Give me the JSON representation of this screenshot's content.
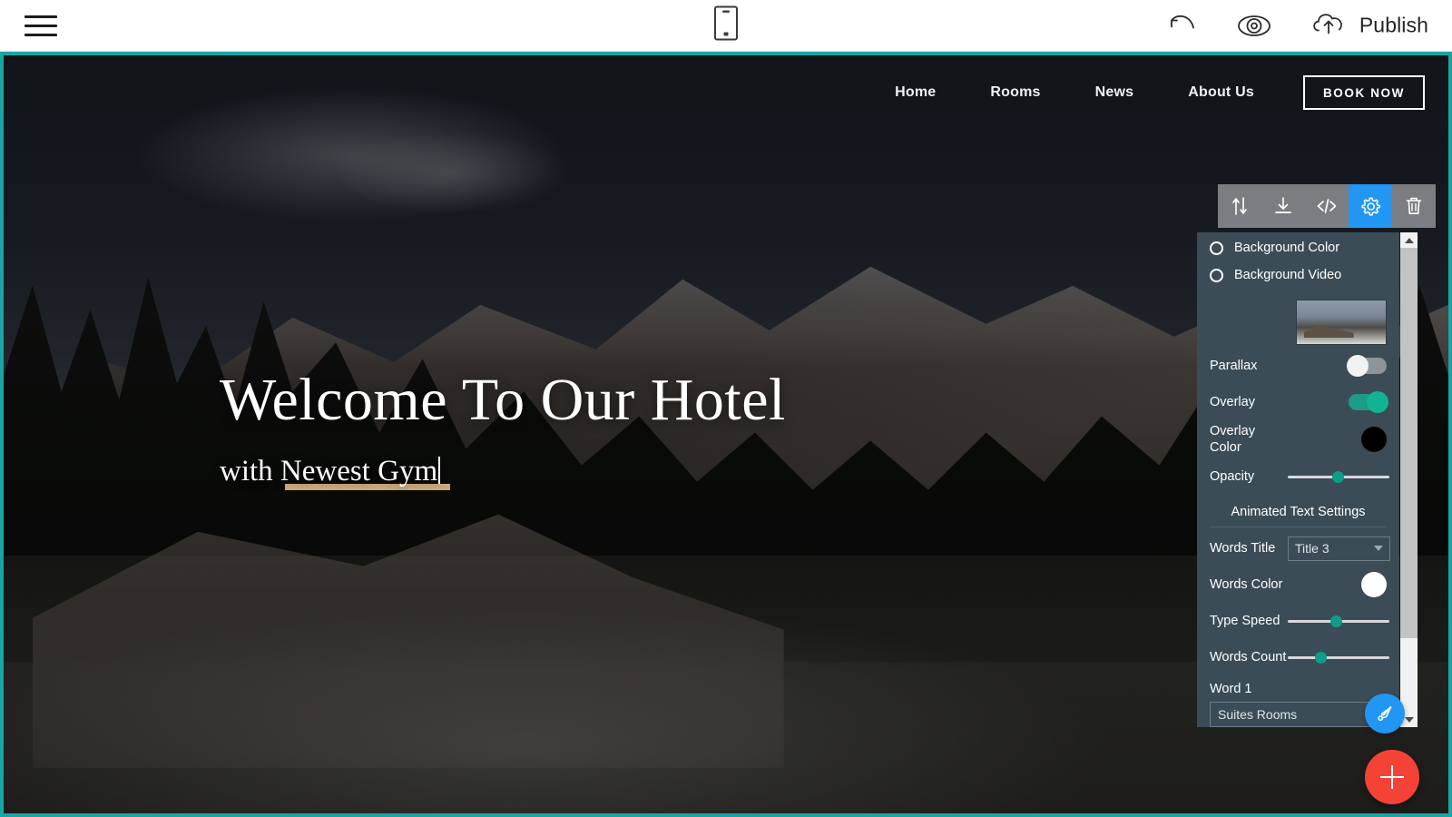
{
  "editor": {
    "topbar": {
      "menu_icon": "hamburger-menu-icon",
      "device_icon": "mobile-device-icon",
      "undo_icon": "undo-arrow-icon",
      "preview_icon": "eye-preview-icon",
      "publish_icon": "cloud-upload-icon",
      "publish_label": "Publish"
    },
    "element_toolbar": {
      "items": [
        {
          "name": "move-section-icon",
          "title": "Move",
          "active": false
        },
        {
          "name": "download-icon",
          "title": "Download",
          "active": false
        },
        {
          "name": "code-icon",
          "title": "Code",
          "active": false
        },
        {
          "name": "gear-settings-icon",
          "title": "Settings",
          "active": true
        },
        {
          "name": "trash-delete-icon",
          "title": "Delete",
          "active": false
        }
      ]
    },
    "fabs": {
      "style_icon": "paintbrush-icon",
      "add_icon": "plus-icon"
    }
  },
  "settings_panel": {
    "radio_options": [
      {
        "label": "Background Color",
        "selected": false
      },
      {
        "label": "Background Video",
        "selected": false
      }
    ],
    "background_thumbnail": "mountain-chalet-thumbnail",
    "controls": [
      {
        "label": "Parallax",
        "type": "toggle",
        "value": "off"
      },
      {
        "label": "Overlay",
        "type": "toggle",
        "value": "on"
      },
      {
        "label": "Overlay Color",
        "type": "color",
        "value": "#000000"
      },
      {
        "label": "Opacity",
        "type": "slider",
        "value": 45
      }
    ],
    "animated_text": {
      "section_title": "Animated Text Settings",
      "words_title_label": "Words Title",
      "words_title_value": "Title 3",
      "words_color_label": "Words Color",
      "words_color_value": "#ffffff",
      "type_speed_label": "Type Speed",
      "type_speed_value": 45,
      "words_count_label": "Words Count",
      "words_count_value": 30,
      "word1_label": "Word 1",
      "word1_value": "Suites Rooms"
    },
    "accent_color": "#12b294",
    "panel_background": "#3b4c56"
  },
  "site": {
    "nav": {
      "links": [
        {
          "label": "Home"
        },
        {
          "label": "Rooms"
        },
        {
          "label": "News"
        },
        {
          "label": "About Us"
        }
      ],
      "cta_label": "BOOK NOW"
    },
    "hero": {
      "title": "Welcome To Our Hotel",
      "subtitle_prefix": "with ",
      "subtitle_animated_word": "Newest Gym",
      "underline_color": "#c9a87c"
    },
    "selection_color": "#1aa5a5"
  }
}
